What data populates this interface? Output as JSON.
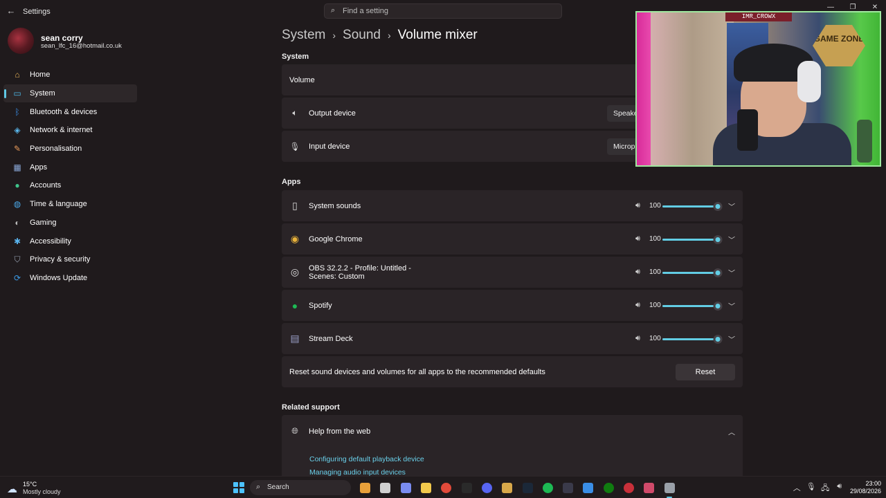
{
  "window": {
    "app_title": "Settings",
    "search_placeholder": "Find a setting"
  },
  "profile": {
    "name": "sean corry",
    "email": "sean_lfc_16@hotmail.co.uk"
  },
  "sidebar": {
    "items": [
      {
        "label": "Home",
        "icon": "home-icon",
        "color": "#e8b45a"
      },
      {
        "label": "System",
        "icon": "system-icon",
        "color": "#4cb8e8"
      },
      {
        "label": "Bluetooth & devices",
        "icon": "bluetooth-icon",
        "color": "#3a8ee6"
      },
      {
        "label": "Network & internet",
        "icon": "wifi-icon",
        "color": "#5ab8ee"
      },
      {
        "label": "Personalisation",
        "icon": "brush-icon",
        "color": "#e89a5a"
      },
      {
        "label": "Apps",
        "icon": "apps-icon",
        "color": "#8aa8d8"
      },
      {
        "label": "Accounts",
        "icon": "accounts-icon",
        "color": "#3fc48a"
      },
      {
        "label": "Time & language",
        "icon": "globe-icon",
        "color": "#4aa8e8"
      },
      {
        "label": "Gaming",
        "icon": "gamepad-icon",
        "color": "#b8b8b8"
      },
      {
        "label": "Accessibility",
        "icon": "accessibility-icon",
        "color": "#5ab4ee"
      },
      {
        "label": "Privacy & security",
        "icon": "shield-icon",
        "color": "#9aa4b4"
      },
      {
        "label": "Windows Update",
        "icon": "update-icon",
        "color": "#3a9ae6"
      }
    ],
    "active_index": 1
  },
  "breadcrumb": {
    "part1": "System",
    "part2": "Sound",
    "current": "Volume mixer",
    "separator": "›"
  },
  "system_section": {
    "title": "System",
    "volume_label": "Volume",
    "output_label": "Output device",
    "output_value": "Speakers",
    "input_label": "Input device",
    "input_value": "Microphone"
  },
  "apps_section": {
    "title": "Apps",
    "apps": [
      {
        "name": "System sounds",
        "icon": "system-sounds-icon",
        "volume": "100",
        "level": 1.0
      },
      {
        "name": "Google Chrome",
        "icon": "chrome-icon",
        "volume": "100",
        "level": 1.0
      },
      {
        "name": "OBS 32.2.2 - Profile: Untitled - Scenes: Custom",
        "icon": "obs-icon",
        "volume": "100",
        "level": 1.0
      },
      {
        "name": "Spotify",
        "icon": "spotify-icon",
        "volume": "100",
        "level": 1.0
      },
      {
        "name": "Stream Deck",
        "icon": "stream-deck-icon",
        "volume": "100",
        "level": 1.0
      }
    ]
  },
  "reset": {
    "text": "Reset sound devices and volumes for all apps to the recommended defaults",
    "button": "Reset"
  },
  "related": {
    "title": "Related support",
    "help_title": "Help from the web",
    "links": [
      "Configuring default playback device",
      "Managing audio input devices"
    ]
  },
  "webcam": {
    "tag": "IMR_CROWX",
    "badge": "GAME ZONE"
  },
  "taskbar": {
    "weather_temp": "15°C",
    "weather_cond": "Mostly cloudy",
    "search_label": "Search",
    "time": "23:00",
    "date": "29/08/2026",
    "icons": [
      {
        "name": "widgets-icon",
        "color": "#e8a03a"
      },
      {
        "name": "task-view-icon",
        "color": "#d0d0d0"
      },
      {
        "name": "copilot-icon",
        "color": "#7a8cf0"
      },
      {
        "name": "file-explorer-icon",
        "color": "#f2c94c"
      },
      {
        "name": "chrome-icon",
        "color": "#e24a3a"
      },
      {
        "name": "app-a-icon",
        "color": "#2a2a2a"
      },
      {
        "name": "discord-icon",
        "color": "#5865f2"
      },
      {
        "name": "app-b-icon",
        "color": "#d8a84a"
      },
      {
        "name": "steam-icon",
        "color": "#1b2838"
      },
      {
        "name": "spotify-icon",
        "color": "#1db954"
      },
      {
        "name": "stream-deck-icon",
        "color": "#3a3a4a"
      },
      {
        "name": "app-c-icon",
        "color": "#3a8ee6"
      },
      {
        "name": "xbox-icon",
        "color": "#107c10"
      },
      {
        "name": "app-d-icon",
        "color": "#c8303a"
      },
      {
        "name": "app-e-icon",
        "color": "#d04a6a"
      },
      {
        "name": "settings-icon",
        "color": "#9aa0a8"
      }
    ],
    "active_icon": 15
  }
}
